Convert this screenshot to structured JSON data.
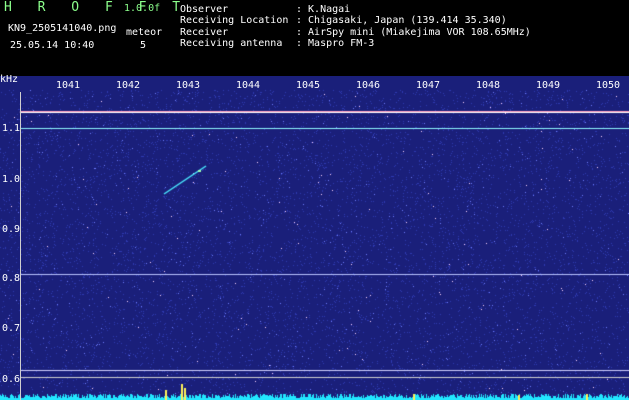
{
  "header": {
    "title": "H R O F F T",
    "version": "1.0.0f",
    "filename": "KN9_2505141040.png",
    "mode_label": "meteor",
    "timestamp": "25.05.14 10:40",
    "mode_value": "5",
    "info_labels": [
      "Observer",
      "Receiving Location",
      "Receiver",
      "Receiving antenna"
    ],
    "info_values": [
      ": K.Nagai",
      ": Chigasaki, Japan (139.414 35.340)",
      ": AirSpy mini (Miakejima VOR 108.65MHz)",
      ": Maspro FM-3"
    ]
  },
  "axis": {
    "unit": "kHz",
    "time_ticks": [
      "1041",
      "1042",
      "1043",
      "1044",
      "1045",
      "1046",
      "1047",
      "1048",
      "1049",
      "1050"
    ],
    "freq_ticks": [
      "1.1",
      "1.0",
      "0.9",
      "0.8",
      "0.7",
      "0.6"
    ]
  },
  "colors": {
    "background": "#1a1f7a",
    "header_bg": "#000000",
    "header_green": "#8cff8c",
    "signal_line": "#ff9fc0",
    "spectrum": "#22e6ff"
  }
}
